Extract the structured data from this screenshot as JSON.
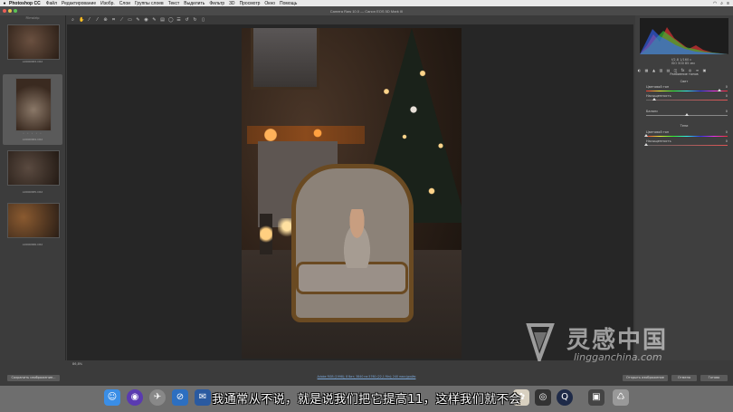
{
  "menubar": {
    "app": "Photoshop CC",
    "items": [
      "Файл",
      "Редактирование",
      "Изобр.",
      "Слои",
      "Группы слоев",
      "Текст",
      "Выделить",
      "Фильтр",
      "3D",
      "Просмотр",
      "Окно",
      "Помощь"
    ]
  },
  "window": {
    "title": "Camera Raw 10.0 — Canon EOS 5D Mark III"
  },
  "filmstrip": {
    "title": "Filmstrip",
    "items": [
      {
        "label": "A0000683.CR2"
      },
      {
        "label": "A0000684.CR2"
      },
      {
        "label": "A0000685.CR2"
      },
      {
        "label": "A0000686.CR2"
      }
    ],
    "dots": "• • • • •"
  },
  "canvas": {
    "filename": "A0000684.CR2"
  },
  "rightpanel": {
    "readout": "f/2.8   1/160 c",
    "readout2": "ISO 500   85 мм",
    "section1": "Разбиение тонов",
    "section_light": "Свет",
    "section_shadow": "Тени",
    "sliders1": [
      {
        "label": "Цветовой тон",
        "value": "0",
        "pos": 0.9,
        "track": "linear-gradient(90deg,#e33,#ee3,#3e3,#3ee,#33e,#e3e,#e33)"
      },
      {
        "label": "Насыщенность",
        "value": "0",
        "pos": 0.1,
        "track": "linear-gradient(90deg,#666,#d55)"
      },
      {
        "label": "Баланс",
        "value": "0",
        "pos": 0.5,
        "track": "#888"
      }
    ],
    "sliders2": [
      {
        "label": "Цветовой тон",
        "value": "0",
        "pos": 0.0,
        "track": "linear-gradient(90deg,#e33,#ee3,#3e3,#3ee,#33e,#e3e,#e33)"
      },
      {
        "label": "Насыщенность",
        "value": "0",
        "pos": 0.0,
        "track": "linear-gradient(90deg,#666,#d55)"
      }
    ]
  },
  "status": {
    "save_label": "Сохранить изображение...",
    "zoom": "86,8%",
    "info": "Adobe RGB (1998); 8 бит; 3840 на 5760 (22,1 Мп); 240 пикс/дюйм",
    "open_label": "Открыть изображение",
    "cancel_label": "Отмена",
    "done_label": "Готово"
  },
  "subtitle": "我通常从不说，就是说我们把它提高11，这样我们就不会",
  "watermark": {
    "brand": "灵感中国",
    "url": "lingganchina.com"
  },
  "dock_icons": [
    "finder-icon",
    "siri-icon",
    "launchpad-icon",
    "safari-icon",
    "mail-icon",
    "photos-icon",
    "photoshop-icon",
    "camera-icon",
    "quicktime-icon",
    "app-icon",
    "trash-icon"
  ]
}
